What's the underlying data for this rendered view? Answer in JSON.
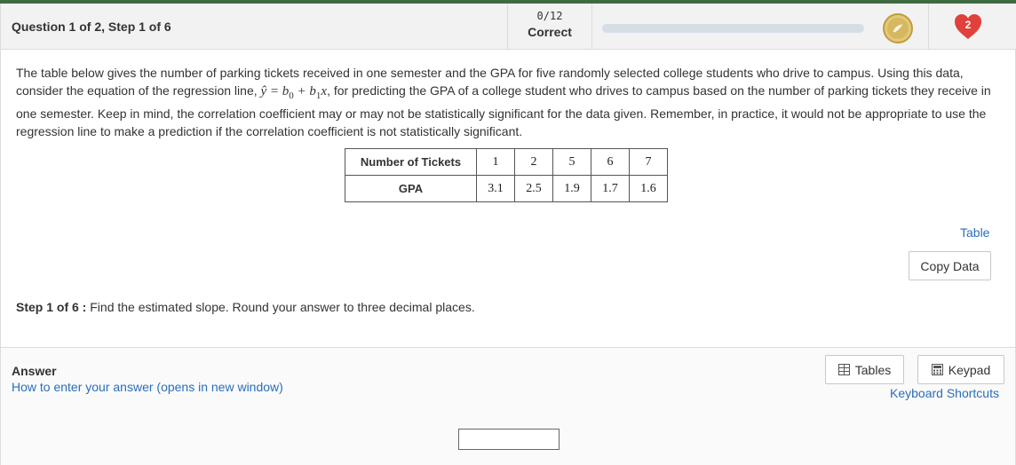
{
  "header": {
    "question_label": "Question 1 of 2, Step 1 of 6",
    "score_count": "0/12",
    "score_label": "Correct",
    "progress_fraction": 0,
    "coin_icon": "coin-icon",
    "hearts_icon": "heart-icon",
    "hearts_count": "2"
  },
  "problem": {
    "text_before_equation": "The table below gives the number of parking tickets received in one semester and the GPA for five randomly selected college students who drive to campus. Using this data, consider the equation of the regression line, ",
    "equation": "ŷ = b₀ + b₁x",
    "text_after_equation": ", for predicting the GPA of a college student who drives to campus based on the number of parking tickets they receive in one semester. Keep in mind, the correlation coefficient may or may not be statistically significant for the data given. Remember, in practice, it would not be appropriate to use the regression line to make a prediction if the correlation coefficient is not statistically significant."
  },
  "data_table": {
    "rows": [
      {
        "header": "Number of Tickets",
        "values": [
          "1",
          "2",
          "5",
          "6",
          "7"
        ]
      },
      {
        "header": "GPA",
        "values": [
          "3.1",
          "2.5",
          "1.9",
          "1.7",
          "1.6"
        ]
      }
    ]
  },
  "links": {
    "table": "Table",
    "copy_data": "Copy Data"
  },
  "step": {
    "label": "Step 1 of 6 :",
    "instruction": "Find the estimated slope. Round your answer to three decimal places."
  },
  "answer": {
    "label": "Answer",
    "howto_link": "How to enter your answer (opens in new window)",
    "tables_button": "Tables",
    "keypad_button": "Keypad",
    "shortcuts_link": "Keyboard Shortcuts",
    "input_value": ""
  },
  "colors": {
    "accent_green": "#3e6b3f",
    "link_blue": "#2a6ebb",
    "heart_red": "#e0413a",
    "coin_gold": "#d6b860"
  }
}
